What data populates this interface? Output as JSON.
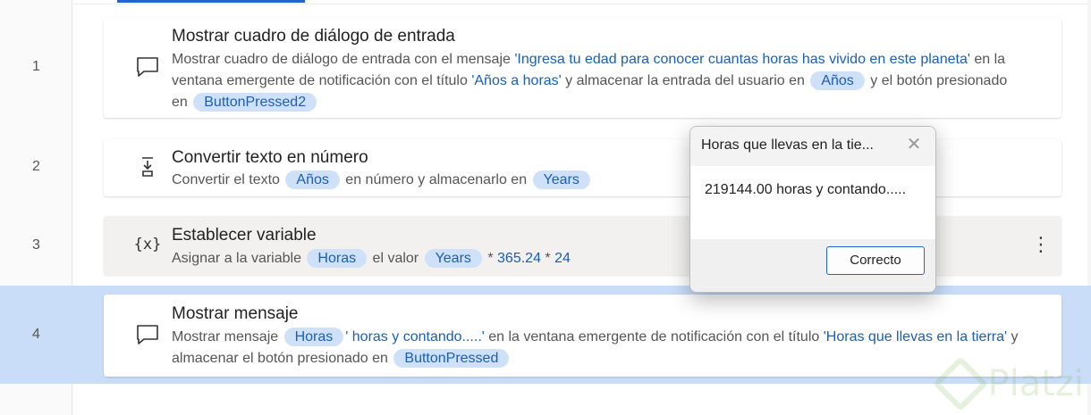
{
  "steps": [
    {
      "line": "1",
      "icon": "message-icon",
      "title": "Mostrar cuadro de diálogo de entrada",
      "desc": {
        "t1": "Mostrar cuadro de diálogo de entrada con el mensaje ",
        "msg": "'Ingresa tu edad para conocer cuantas horas has vivido en este planeta'",
        "t2": " en la ventana emergente de notificación con el título ",
        "title": "'Años a horas'",
        "t3": " y almacenar la entrada del usuario en ",
        "var1": "Años",
        "t4": " y el botón presionado en ",
        "var2": "ButtonPressed2"
      }
    },
    {
      "line": "2",
      "icon": "convert-number-icon",
      "title": "Convertir texto en número",
      "desc": {
        "t1": "Convertir el texto ",
        "var1": "Años",
        "t2": " en número y almacenarlo en ",
        "var2": "Years"
      }
    },
    {
      "line": "3",
      "icon": "variable-icon",
      "icon_text": "{x}",
      "title": "Establecer variable",
      "desc": {
        "t1": "Asignar a la variable ",
        "var1": "Horas",
        "t2": " el valor ",
        "var2": "Years",
        "t3": " * ",
        "n1": "365.24",
        "t4": " * ",
        "n2": "24"
      },
      "more": "⋮"
    },
    {
      "line": "4",
      "icon": "message-icon",
      "title": "Mostrar mensaje",
      "desc": {
        "t1": "Mostrar mensaje ",
        "var1": "Horas",
        "msg": "' horas y contando.....'",
        "t2": " en la ventana emergente de notificación con el título ",
        "title": "'Horas que llevas en la tierra'",
        "t3": " y almacenar el botón presionado en ",
        "var2": "ButtonPressed"
      }
    }
  ],
  "dialog": {
    "title": "Horas que llevas en la tie...",
    "close": "✕",
    "message": "219144.00 horas y contando.....",
    "ok_label": "Correcto"
  },
  "watermark": "Platzi",
  "colors": {
    "accent": "#2564cf",
    "selected_row": "#c9dcf8",
    "pill_bg": "#cfe1f9",
    "link_text": "#1a5fb4"
  }
}
